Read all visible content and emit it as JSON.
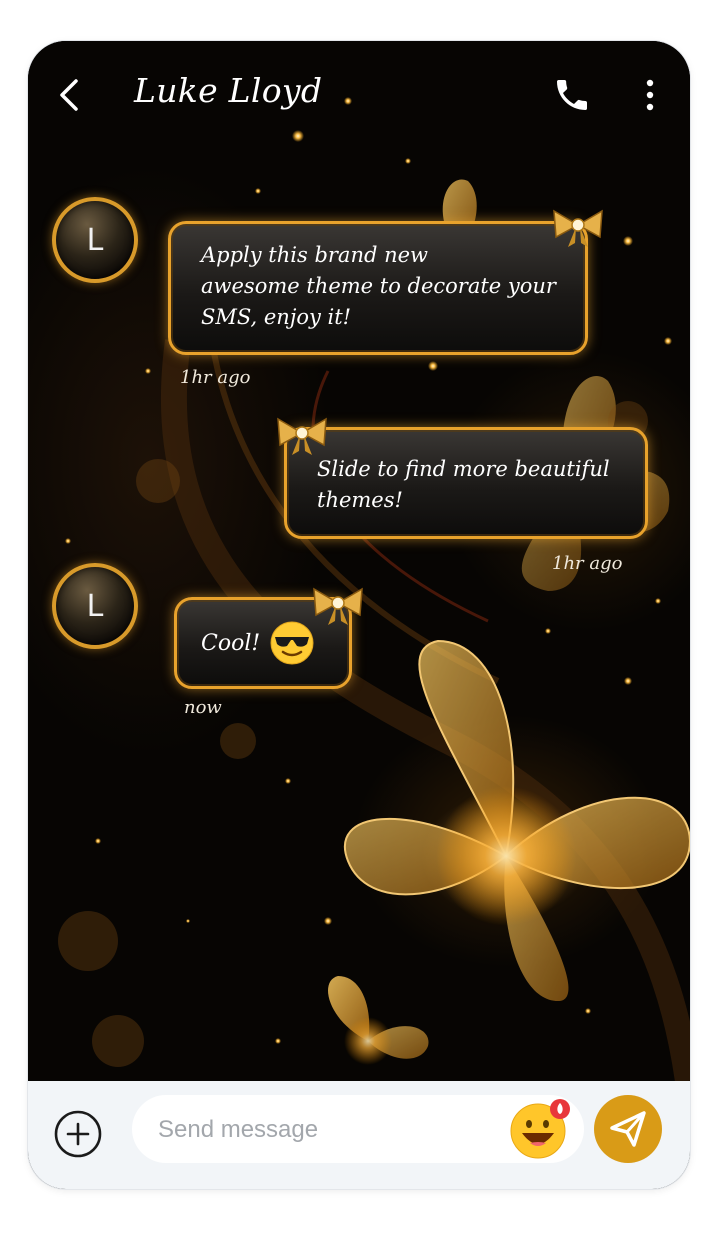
{
  "header": {
    "contact_name": "Luke Lloyd",
    "back_icon": "chevron-left-icon",
    "call_icon": "phone-icon",
    "more_icon": "more-vertical-icon"
  },
  "messages": [
    {
      "direction": "incoming",
      "avatar_letter": "L",
      "lines": [
        "Apply this brand new",
        "awesome theme to decorate your",
        "SMS, enjoy it!"
      ],
      "time": "1hr ago"
    },
    {
      "direction": "outgoing",
      "lines": [
        "Slide to find more beautiful",
        "themes!"
      ],
      "time": "1hr ago"
    },
    {
      "direction": "incoming",
      "avatar_letter": "L",
      "lines": [
        "Cool!"
      ],
      "emoji": "sunglasses-face",
      "time": "now"
    }
  ],
  "composer": {
    "add_icon": "plus-circle-icon",
    "placeholder": "Send message",
    "emoji_icon": "grinning-face-icon",
    "send_icon": "send-icon"
  },
  "colors": {
    "accent_gold": "#e8a22c",
    "send_button": "#d99b17",
    "composer_bg": "#f2f5f8"
  }
}
